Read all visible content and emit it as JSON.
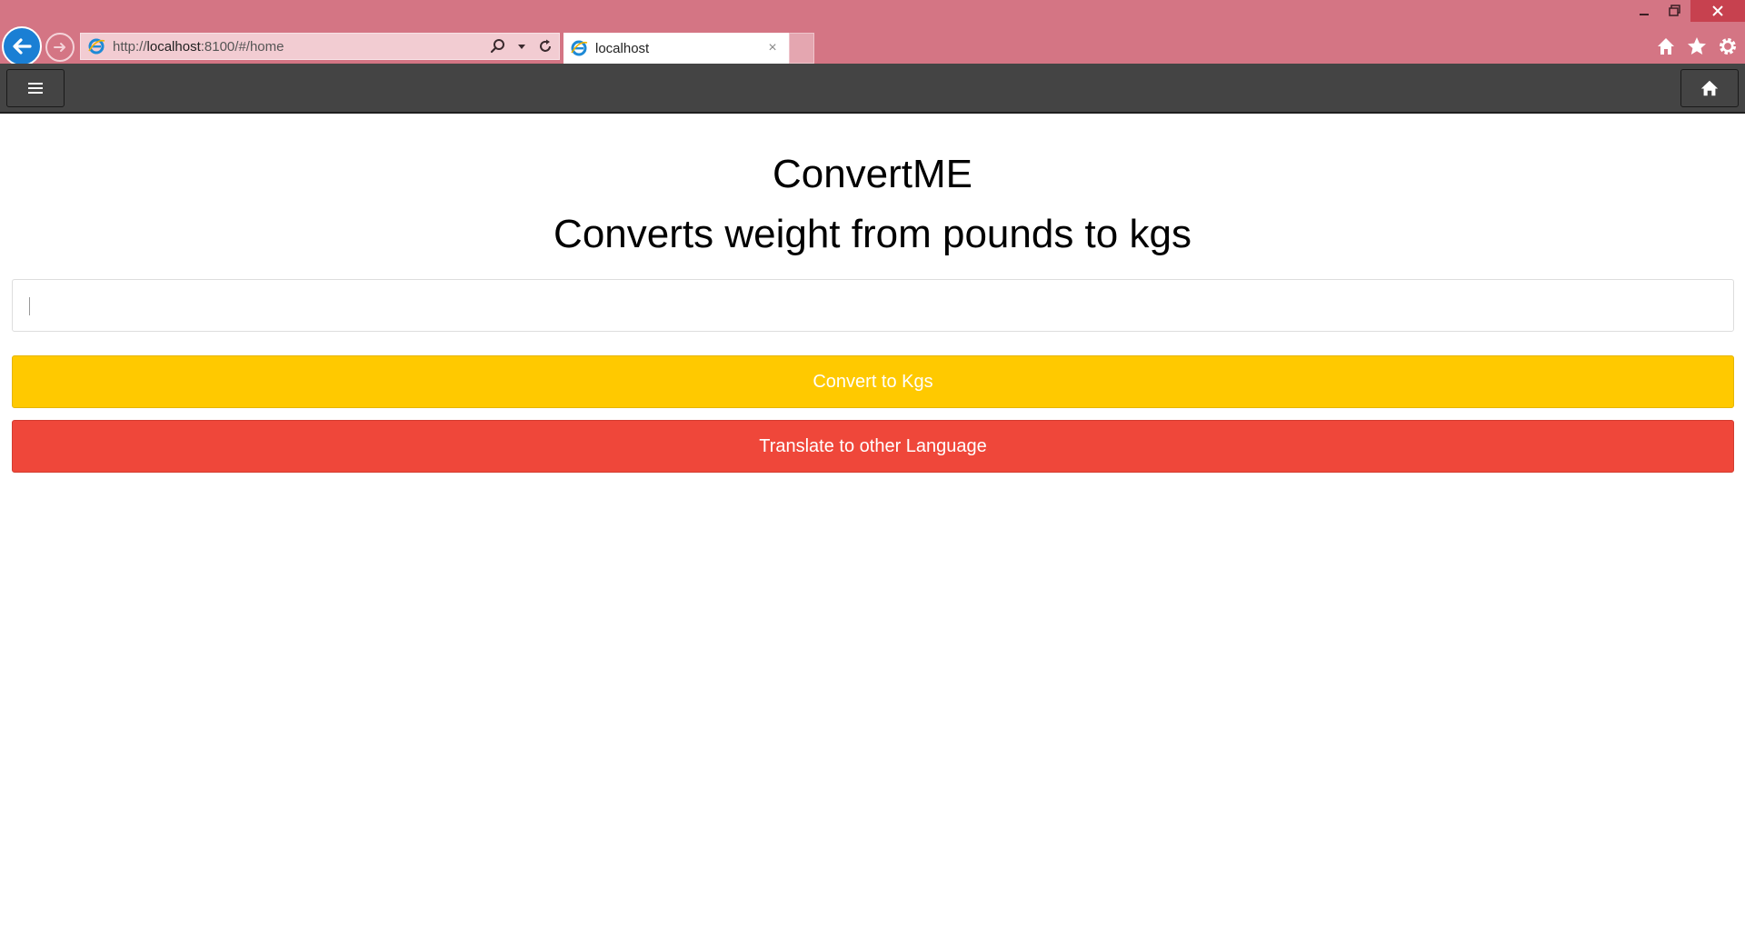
{
  "browser": {
    "url_prefix": "http://",
    "url_host": "localhost",
    "url_rest": ":8100/#/home",
    "tab_title": "localhost",
    "tab_close": "×",
    "window_controls": {
      "minimize_icon": "minimize-icon",
      "restore_icon": "restore-icon",
      "close_icon": "close-icon"
    },
    "right_icons": [
      "home-icon",
      "star-icon",
      "gear-icon"
    ]
  },
  "app_header": {
    "menu_icon": "hamburger-menu-icon",
    "home_icon": "home-icon",
    "background": "#444444"
  },
  "main": {
    "title": "ConvertME",
    "subtitle": "Converts weight from pounds to kgs",
    "input": {
      "value": "",
      "placeholder": ""
    },
    "convert_button_label": "Convert to Kgs",
    "translate_button_label": "Translate to other Language"
  },
  "colors": {
    "chrome": "#d47584",
    "convert_button": "#ffc900",
    "translate_button": "#ef473a",
    "back_button": "#1a7fd4"
  }
}
